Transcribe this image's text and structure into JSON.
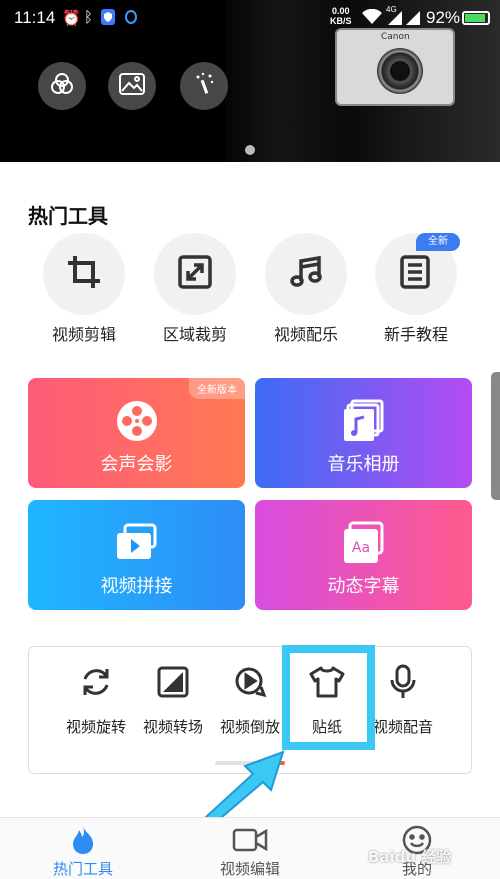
{
  "status_bar": {
    "time": "11:14",
    "net_speed_value": "0.00",
    "net_speed_unit": "KB/S",
    "battery": "92%",
    "network": "4G"
  },
  "banner": {
    "camera_brand": "Canon",
    "buttons": [
      "filter-icon",
      "image-icon",
      "magic-wand-icon"
    ]
  },
  "hot_tools": {
    "title": "热门工具",
    "new_badge": "全新",
    "items": [
      {
        "label": "视频剪辑",
        "icon": "crop-icon"
      },
      {
        "label": "区域裁剪",
        "icon": "resize-icon"
      },
      {
        "label": "视频配乐",
        "icon": "music-note-icon"
      },
      {
        "label": "新手教程",
        "icon": "tutorial-icon"
      }
    ]
  },
  "cards": [
    {
      "label": "会声会影",
      "tag": "全新版本",
      "icon": "film-reel-icon",
      "color": "#ff6a66"
    },
    {
      "label": "音乐相册",
      "icon": "music-album-icon",
      "color": "#6e5cf3"
    },
    {
      "label": "视频拼接",
      "icon": "video-stack-icon",
      "color": "#22a6fb"
    },
    {
      "label": "动态字幕",
      "icon": "subtitle-icon",
      "color": "#ea50b6"
    }
  ],
  "mini_tools": [
    {
      "label": "视频旋转",
      "icon": "rotate-icon"
    },
    {
      "label": "视频转场",
      "icon": "transition-icon"
    },
    {
      "label": "视频倒放",
      "icon": "reverse-play-icon"
    },
    {
      "label": "贴纸",
      "icon": "tshirt-icon"
    },
    {
      "label": "视频配音",
      "icon": "microphone-icon"
    }
  ],
  "bottom_nav": [
    {
      "label": "热门工具",
      "icon": "flame-icon",
      "active": true
    },
    {
      "label": "视频编辑",
      "icon": "video-camera-icon",
      "active": false
    },
    {
      "label": "我的",
      "icon": "smiley-icon",
      "active": false
    }
  ],
  "watermark": "Baidu 经验",
  "colors": {
    "accent": "#2f8cf0",
    "highlight": "#3bc8f5"
  }
}
